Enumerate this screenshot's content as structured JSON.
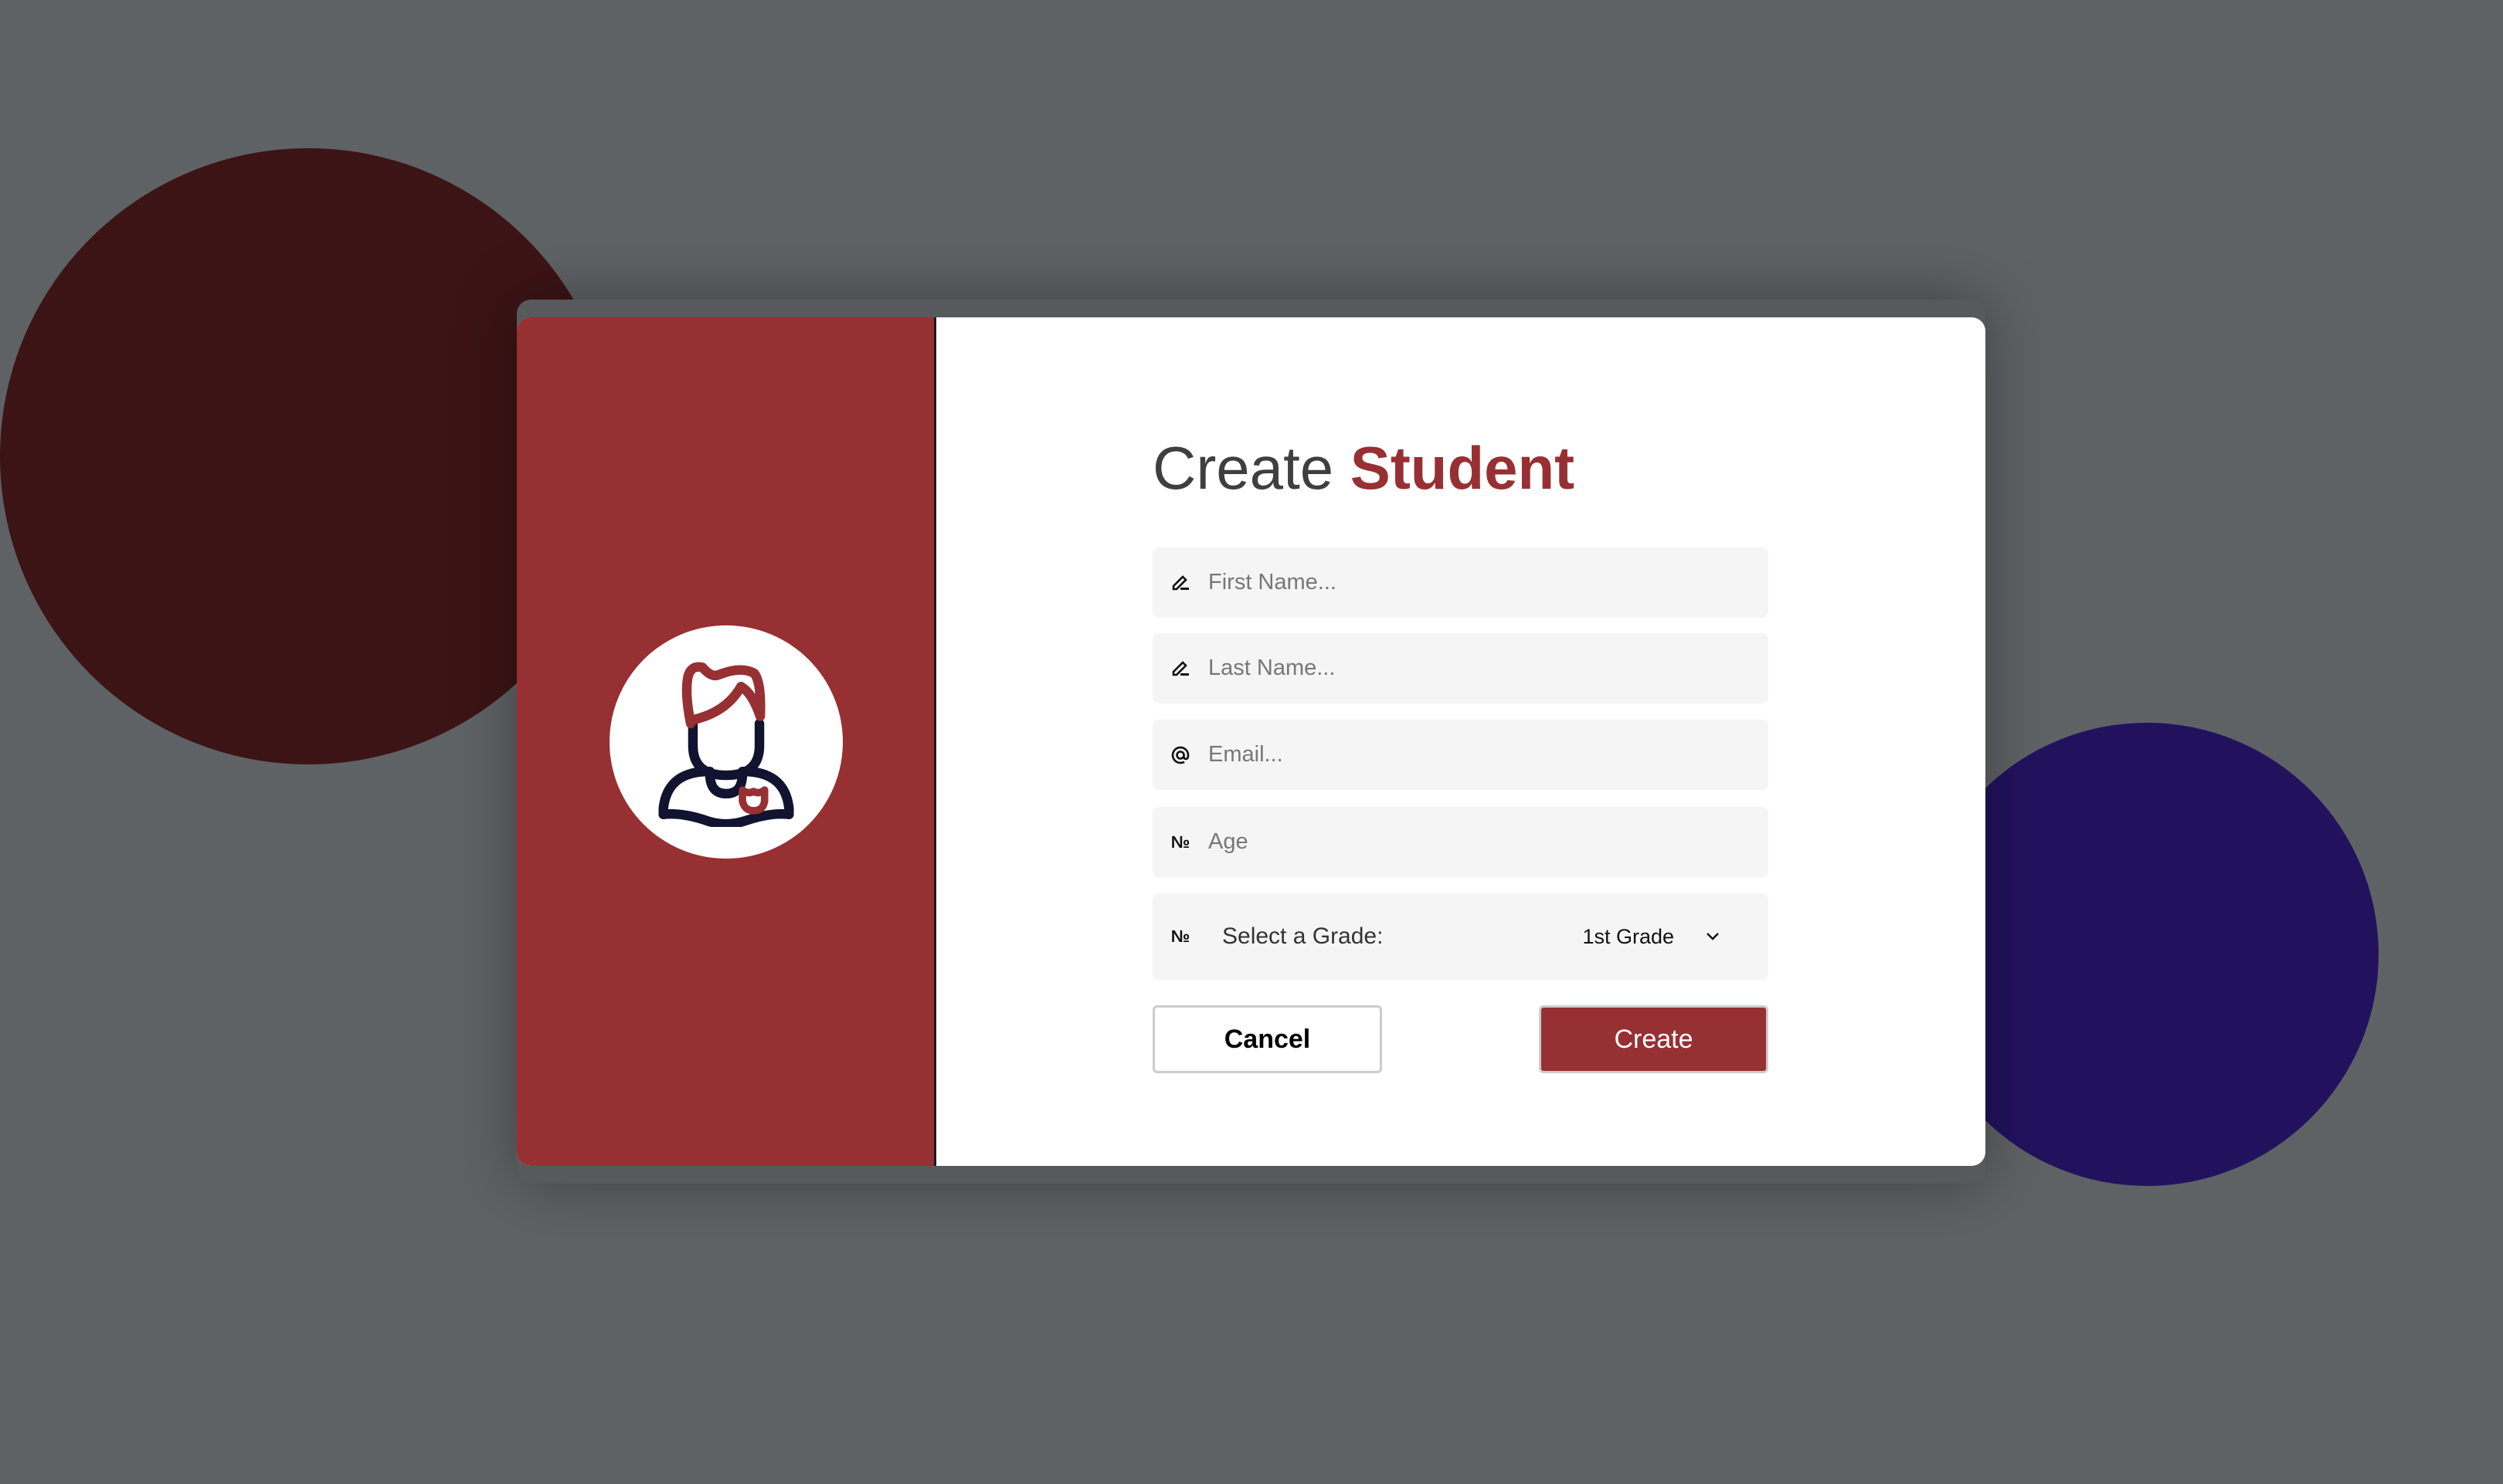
{
  "colors": {
    "accent": "#973033",
    "background": "#5f6265",
    "blob_red": "#3c1415",
    "blob_purple": "#22125e",
    "avatar_outline": "#121330"
  },
  "title": {
    "prefix": "Create",
    "highlight": "Student"
  },
  "fields": [
    {
      "icon": "pencil-icon",
      "placeholder": "First Name..."
    },
    {
      "icon": "pencil-icon",
      "placeholder": "Last Name..."
    },
    {
      "icon": "at-icon",
      "placeholder": "Email..."
    },
    {
      "icon": "numero-icon",
      "placeholder": "Age"
    }
  ],
  "grade": {
    "icon": "numero-icon",
    "label": "Select a Grade:",
    "value": "1st Grade"
  },
  "buttons": {
    "cancel": "Cancel",
    "create": "Create"
  }
}
